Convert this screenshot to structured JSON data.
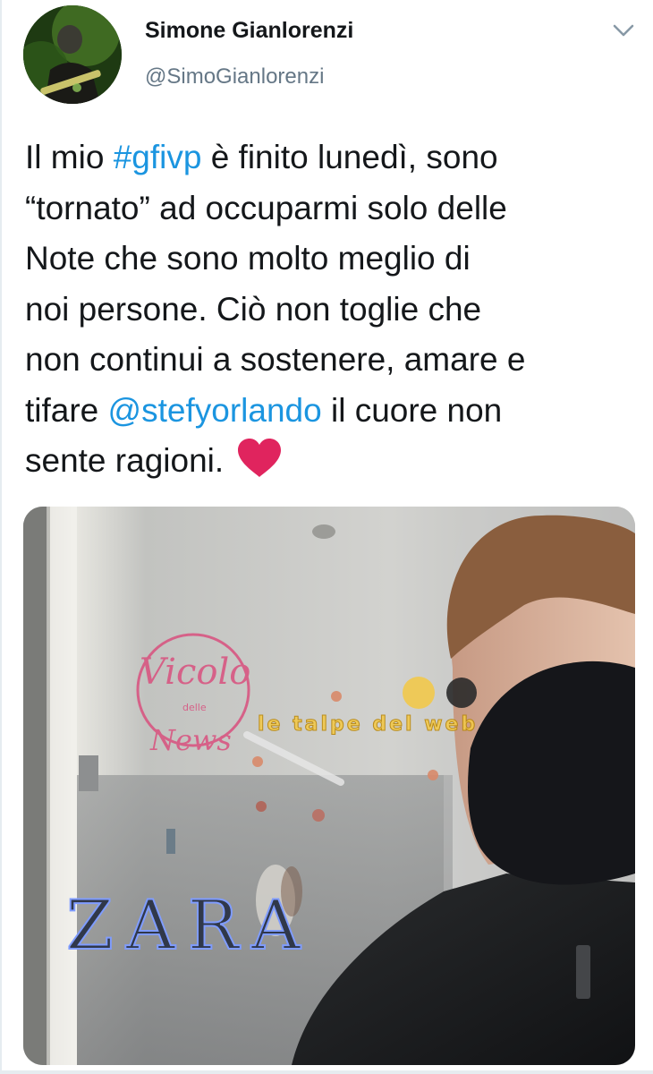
{
  "tweet": {
    "author_name": "Simone Gianlorenzi",
    "author_handle": "@SimoGianlorenzi",
    "text_before_hashtag": "Il mio ",
    "hashtag": "#gfivp",
    "text_after_hashtag": " è finito lunedì, sono\n“tornato” ad occuparmi solo delle\nNote che sono molto meglio di\nnoi persone. Ciò non toglie che\nnon continui a sostenere, amare e\ntifare ",
    "mention": "@stefyorlando",
    "text_after_mention": " il cuore non\nsente ragioni. ",
    "emoji": "heart-emoji"
  },
  "media": {
    "store_sign": "ZARA",
    "watermark_left_script_1": "Vicolo",
    "watermark_left_small": "delle",
    "watermark_left_script_2": "News",
    "watermark_right": "le talpe del web"
  },
  "colors": {
    "link": "#1b95e0",
    "text": "#14171a",
    "secondary": "#657786",
    "heart": "#e0245e"
  },
  "icons": {
    "menu": "chevron-down-icon",
    "emoji": "heart-icon"
  }
}
